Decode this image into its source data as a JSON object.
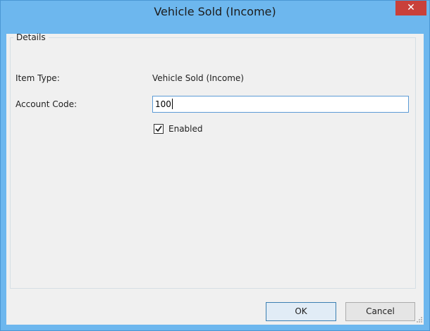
{
  "window": {
    "title": "Vehicle Sold (Income)",
    "close_icon": "close-icon",
    "colors": {
      "titlebar": "#6db7ee",
      "close": "#c9403a",
      "client": "#f0f0f0"
    }
  },
  "details": {
    "group_label": "Details",
    "item_type_label": "Item Type:",
    "item_type_value": "Vehicle Sold (Income)",
    "account_code_label": "Account Code:",
    "account_code_value": "100",
    "enabled_label": "Enabled",
    "enabled_checked": true
  },
  "buttons": {
    "ok_label": "OK",
    "cancel_label": "Cancel"
  }
}
